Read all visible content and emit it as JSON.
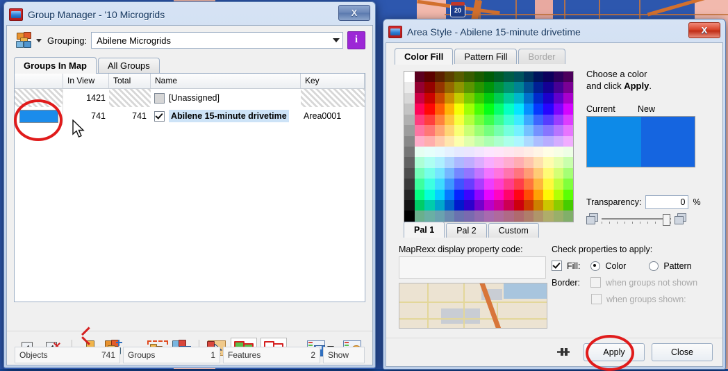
{
  "background": {
    "highway_shield": "20"
  },
  "group_manager": {
    "title": "Group Manager - '10 Microgrids",
    "close_label": "X",
    "app_icon": "map-app-icon",
    "toolbar": {
      "grouping_icon": "grouping-icon",
      "grouping_label": "Grouping:",
      "grouping_value": "Abilene Microgrids",
      "info_label": "i"
    },
    "tabs": [
      {
        "label": "Groups In Map",
        "active": true
      },
      {
        "label": "All Groups",
        "active": false
      }
    ],
    "columns": [
      "",
      "In View",
      "Total",
      "Name",
      "Key"
    ],
    "rows": [
      {
        "style": "hatch",
        "in_view": "1421",
        "total": "",
        "checked": false,
        "name": "[Unassigned]",
        "key": "",
        "selected": false
      },
      {
        "style": "blue",
        "in_view": "741",
        "total": "741",
        "checked": true,
        "name": "Abilene 15-minute drivetime",
        "key": "Area0001",
        "selected": true
      }
    ],
    "bottom_toolbar": [
      "check-all-icon",
      "uncheck-all-icon",
      "delete-group-icon",
      "add-group-icon",
      "new-group-from-selection-icon",
      "save-group-icon",
      "select-on-map-icon",
      "show-groups-filled-icon",
      "show-groups-outline-icon",
      "save-groups-icon",
      "group-settings-icon"
    ],
    "status": [
      {
        "label": "Objects",
        "value": "741"
      },
      {
        "label": "Groups",
        "value": "1"
      },
      {
        "label": "Features",
        "value": "2"
      },
      {
        "label": "Show",
        "value": ""
      }
    ]
  },
  "area_style": {
    "title": "Area Style - Abilene 15-minute drivetime",
    "close_label": "X",
    "tabs": [
      {
        "label": "Color Fill",
        "active": true,
        "disabled": false
      },
      {
        "label": "Pattern Fill",
        "active": false,
        "disabled": false
      },
      {
        "label": "Border",
        "active": false,
        "disabled": true
      }
    ],
    "palette_tabs": [
      {
        "label": "Pal 1",
        "active": true
      },
      {
        "label": "Pal 2",
        "active": false
      },
      {
        "label": "Custom",
        "active": false
      }
    ],
    "hint_line1": "Choose a color",
    "hint_line2_pre": "and click ",
    "hint_line2_bold": "Apply",
    "hint_line2_post": ".",
    "current_label": "Current",
    "new_label": "New",
    "current_color": "#0d8ae8",
    "new_color": "#1565e0",
    "transparency_label": "Transparency:",
    "transparency_value": "0",
    "transparency_unit": "%",
    "code_label": "MapRexx display property code:",
    "code_value": "",
    "properties_label": "Check properties to apply:",
    "fill_label": "Fill:",
    "fill_checked": true,
    "radio_color": "Color",
    "radio_pattern": "Pattern",
    "radio_selected": "Color",
    "border_label": "Border:",
    "border_opt1": "when groups not shown",
    "border_opt2": "when groups shown:",
    "apply_label": "Apply",
    "close_button_label": "Close"
  }
}
